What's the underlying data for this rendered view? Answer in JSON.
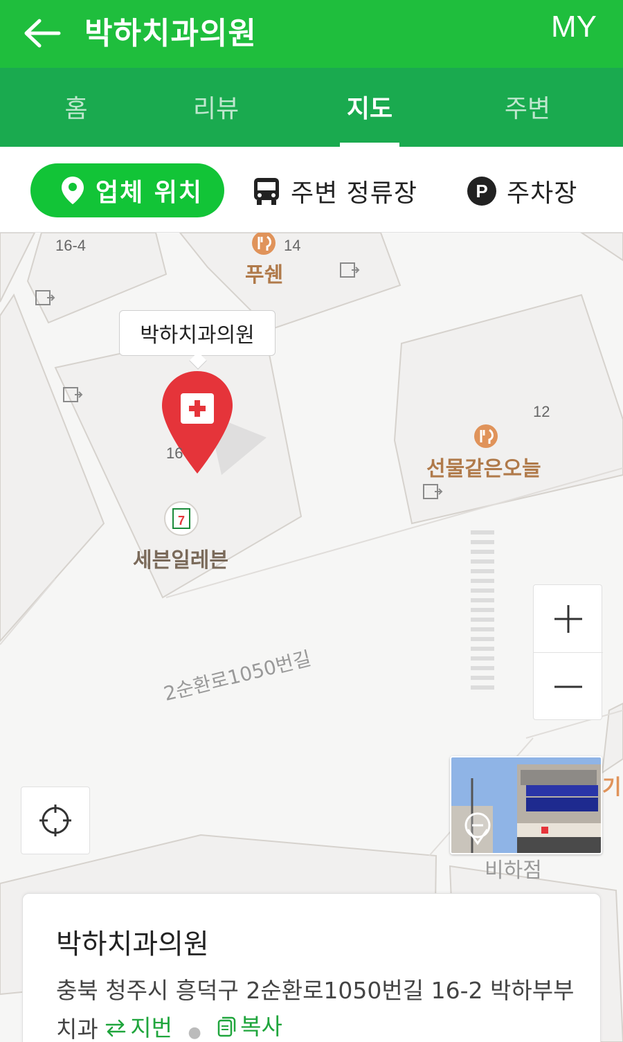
{
  "header": {
    "title": "박하치과의원",
    "my_label": "MY"
  },
  "tabs": [
    {
      "label": "홈",
      "active": false
    },
    {
      "label": "리뷰",
      "active": false
    },
    {
      "label": "지도",
      "active": true
    },
    {
      "label": "주변",
      "active": false
    }
  ],
  "filters": {
    "business_location": "업체 위치",
    "nearby_stops": "주변 정류장",
    "parking": "주차장"
  },
  "map": {
    "pin_callout": "박하치과의원",
    "pois": [
      {
        "name": "푸쉔",
        "number": "14"
      },
      {
        "name": "선물같은오늘",
        "number": "12"
      },
      {
        "name": "세븐일레븐"
      }
    ],
    "lot_numbers": [
      "16-4",
      "16"
    ],
    "road_name": "2순환로1050번길",
    "edge_texts": [
      "기리",
      "비하점"
    ]
  },
  "info_card": {
    "name": "박하치과의원",
    "address": "충북 청주시 흥덕구 2순환로1050번길 16-2 박하부부치과",
    "lot_label": "지번",
    "copy_label": "복사"
  },
  "colors": {
    "header_green": "#1fbe3d",
    "tab_green": "#1aaa4f",
    "chip_green": "#12c437",
    "pin_red": "#e5343a",
    "poi_brown": "#b07a4a",
    "link_green": "#1fa53c"
  }
}
